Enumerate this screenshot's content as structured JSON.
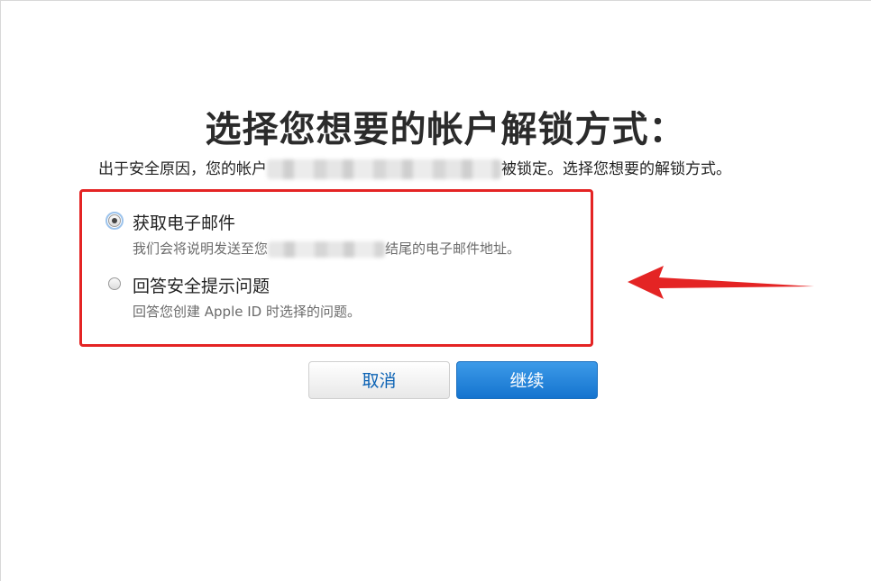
{
  "page": {
    "title": "选择您想要的帐户解锁方式：",
    "subtitle_prefix": "出于安全原因，您的帐户",
    "subtitle_suffix": "被锁定。选择您想要的解锁方式。"
  },
  "options": [
    {
      "label": "获取电子邮件",
      "desc_prefix": "我们会将说明发送至您",
      "desc_suffix": "结尾的电子邮件地址。",
      "selected": true
    },
    {
      "label": "回答安全提示问题",
      "desc": "回答您创建 Apple ID 时选择的问题。",
      "selected": false
    }
  ],
  "buttons": {
    "cancel_label": "取消",
    "continue_label": "继续"
  },
  "annotation": {
    "highlight_color": "#e42424",
    "arrow_color": "#e42424",
    "icon": "red-arrow-left"
  }
}
